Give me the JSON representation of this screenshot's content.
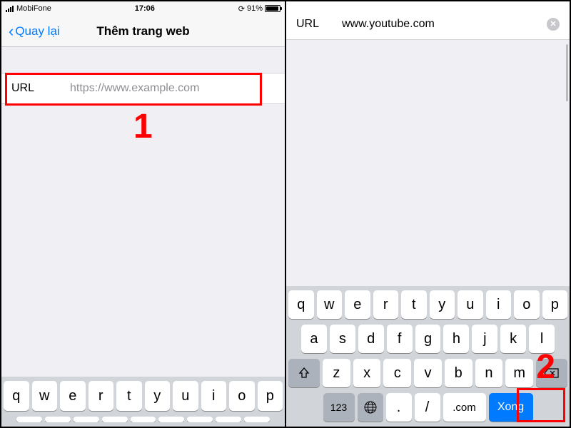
{
  "statusBar": {
    "carrier": "MobiFone",
    "time": "17:06",
    "batteryPercent": "91%"
  },
  "leftPanel": {
    "back": "Quay lại",
    "title": "Thêm trang web",
    "urlLabel": "URL",
    "urlPlaceholder": "https://www.example.com",
    "urlValue": ""
  },
  "rightPanel": {
    "urlLabel": "URL",
    "urlValue": "www.youtube.com"
  },
  "keyboard": {
    "row1": [
      "q",
      "w",
      "e",
      "r",
      "t",
      "y",
      "u",
      "i",
      "o",
      "p"
    ],
    "row2": [
      "a",
      "s",
      "d",
      "f",
      "g",
      "h",
      "j",
      "k",
      "l"
    ],
    "row3": [
      "z",
      "x",
      "c",
      "v",
      "b",
      "n",
      "m"
    ],
    "numKey": "123",
    "dotKey": ".",
    "slashKey": "/",
    "comKey": ".com",
    "doneKey": "Xong"
  },
  "annotations": {
    "one": "1",
    "two": "2"
  }
}
